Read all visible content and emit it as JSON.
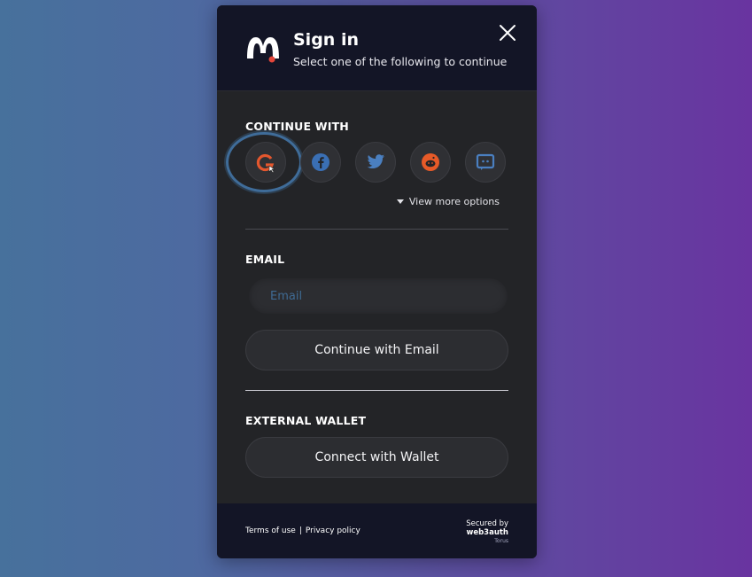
{
  "header": {
    "title": "Sign in",
    "subtitle": "Select one of the following to continue"
  },
  "social": {
    "section_label": "CONTINUE WITH",
    "providers": [
      {
        "name": "google",
        "icon": "google-icon"
      },
      {
        "name": "facebook",
        "icon": "facebook-icon"
      },
      {
        "name": "twitter",
        "icon": "twitter-icon"
      },
      {
        "name": "reddit",
        "icon": "reddit-icon"
      },
      {
        "name": "discord",
        "icon": "discord-icon"
      }
    ],
    "view_more_label": "View more options"
  },
  "email": {
    "section_label": "EMAIL",
    "placeholder": "Email",
    "value": "",
    "continue_label": "Continue with Email"
  },
  "wallet": {
    "section_label": "EXTERNAL WALLET",
    "connect_label": "Connect with Wallet"
  },
  "footer": {
    "terms_label": "Terms of use",
    "separator": "|",
    "privacy_label": "Privacy policy",
    "secured_by": "Secured by",
    "brand": "web3auth",
    "brand_sub": "Torus"
  },
  "colors": {
    "accent_ring": "#3f6c99",
    "modal_bg": "#232427",
    "header_bg": "#131526",
    "brand_logo": "#ffffff",
    "logo_dot": "#e4463a"
  }
}
